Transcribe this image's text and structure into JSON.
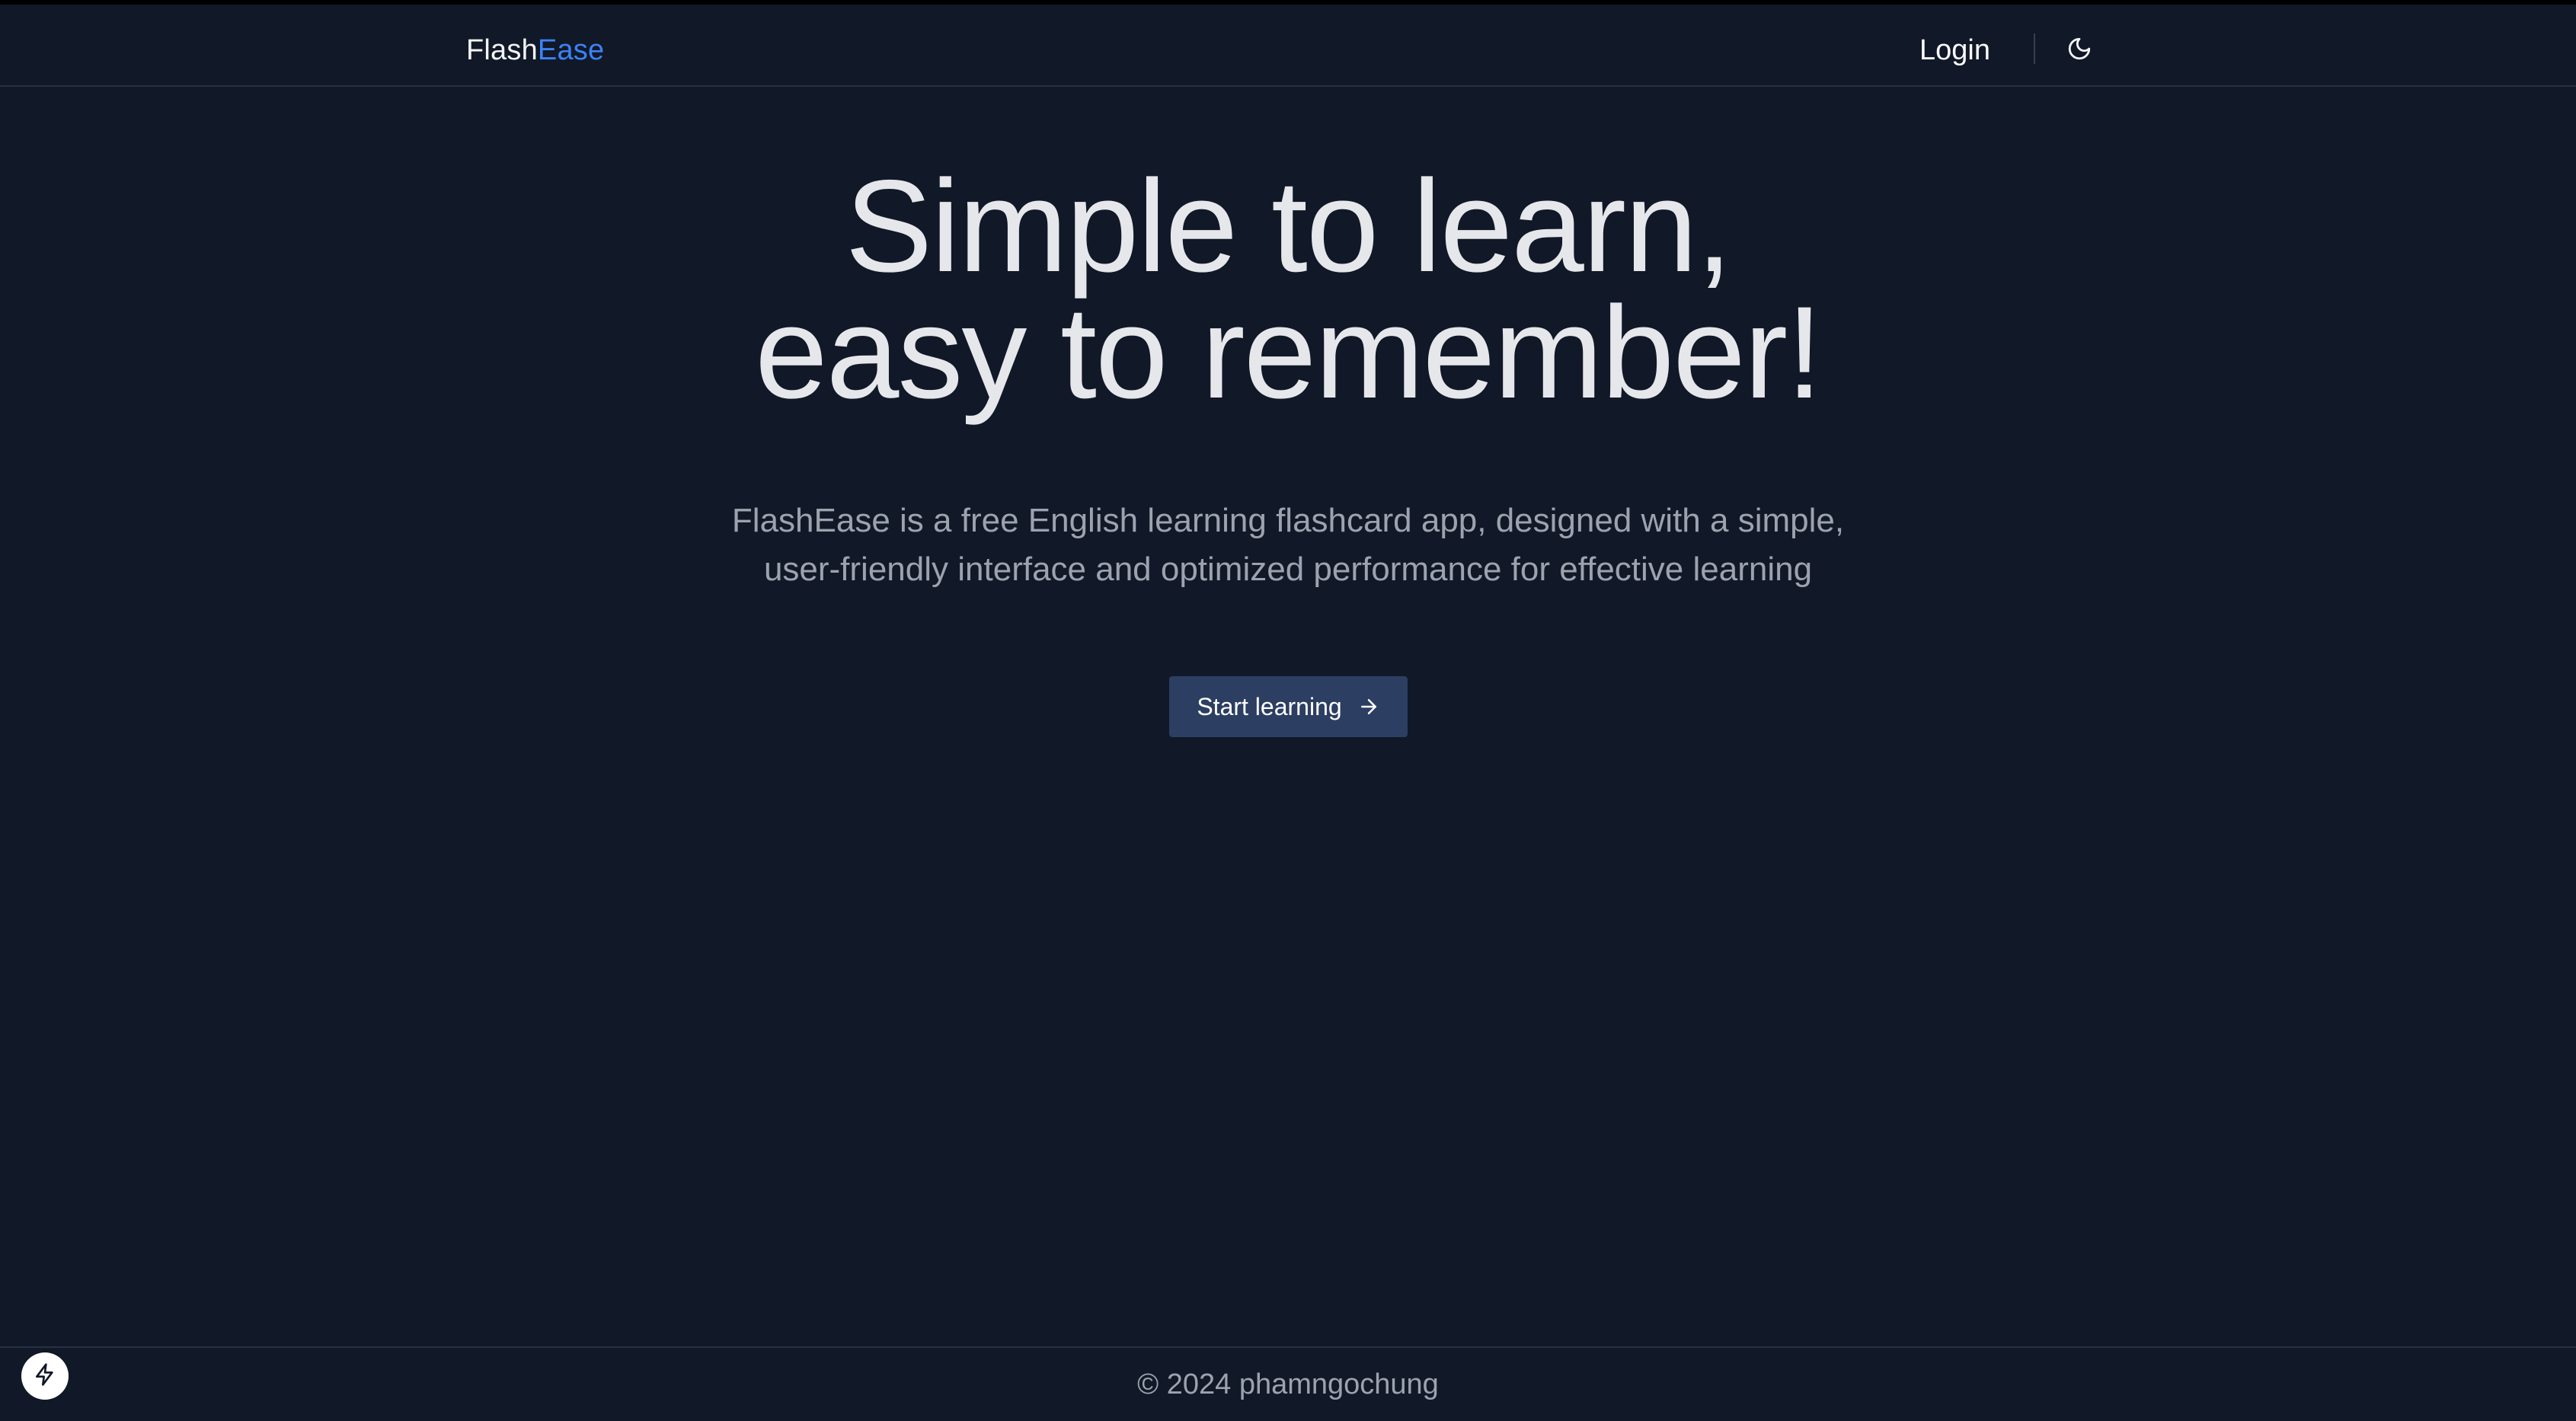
{
  "header": {
    "logo_prefix": "Flash",
    "logo_suffix": "Ease",
    "login_label": "Login",
    "theme_toggle_icon": "moon-icon"
  },
  "hero": {
    "title_line1": "Simple to learn,",
    "title_line2": "easy to remember!",
    "subtitle_line1": "FlashEase is a free English learning flashcard app, designed with a simple,",
    "subtitle_line2": "user-friendly interface and optimized performance for effective learning",
    "cta_label": "Start learning",
    "cta_icon": "arrow-right-icon"
  },
  "footer": {
    "copyright": "© 2024 phamngochung"
  },
  "corner_badge": {
    "icon": "lightning-icon"
  },
  "colors": {
    "background": "#111827",
    "accent": "#3b82f6",
    "button": "#2c3e62",
    "title_text": "#e5e7eb",
    "muted_text": "#9ca3af"
  }
}
